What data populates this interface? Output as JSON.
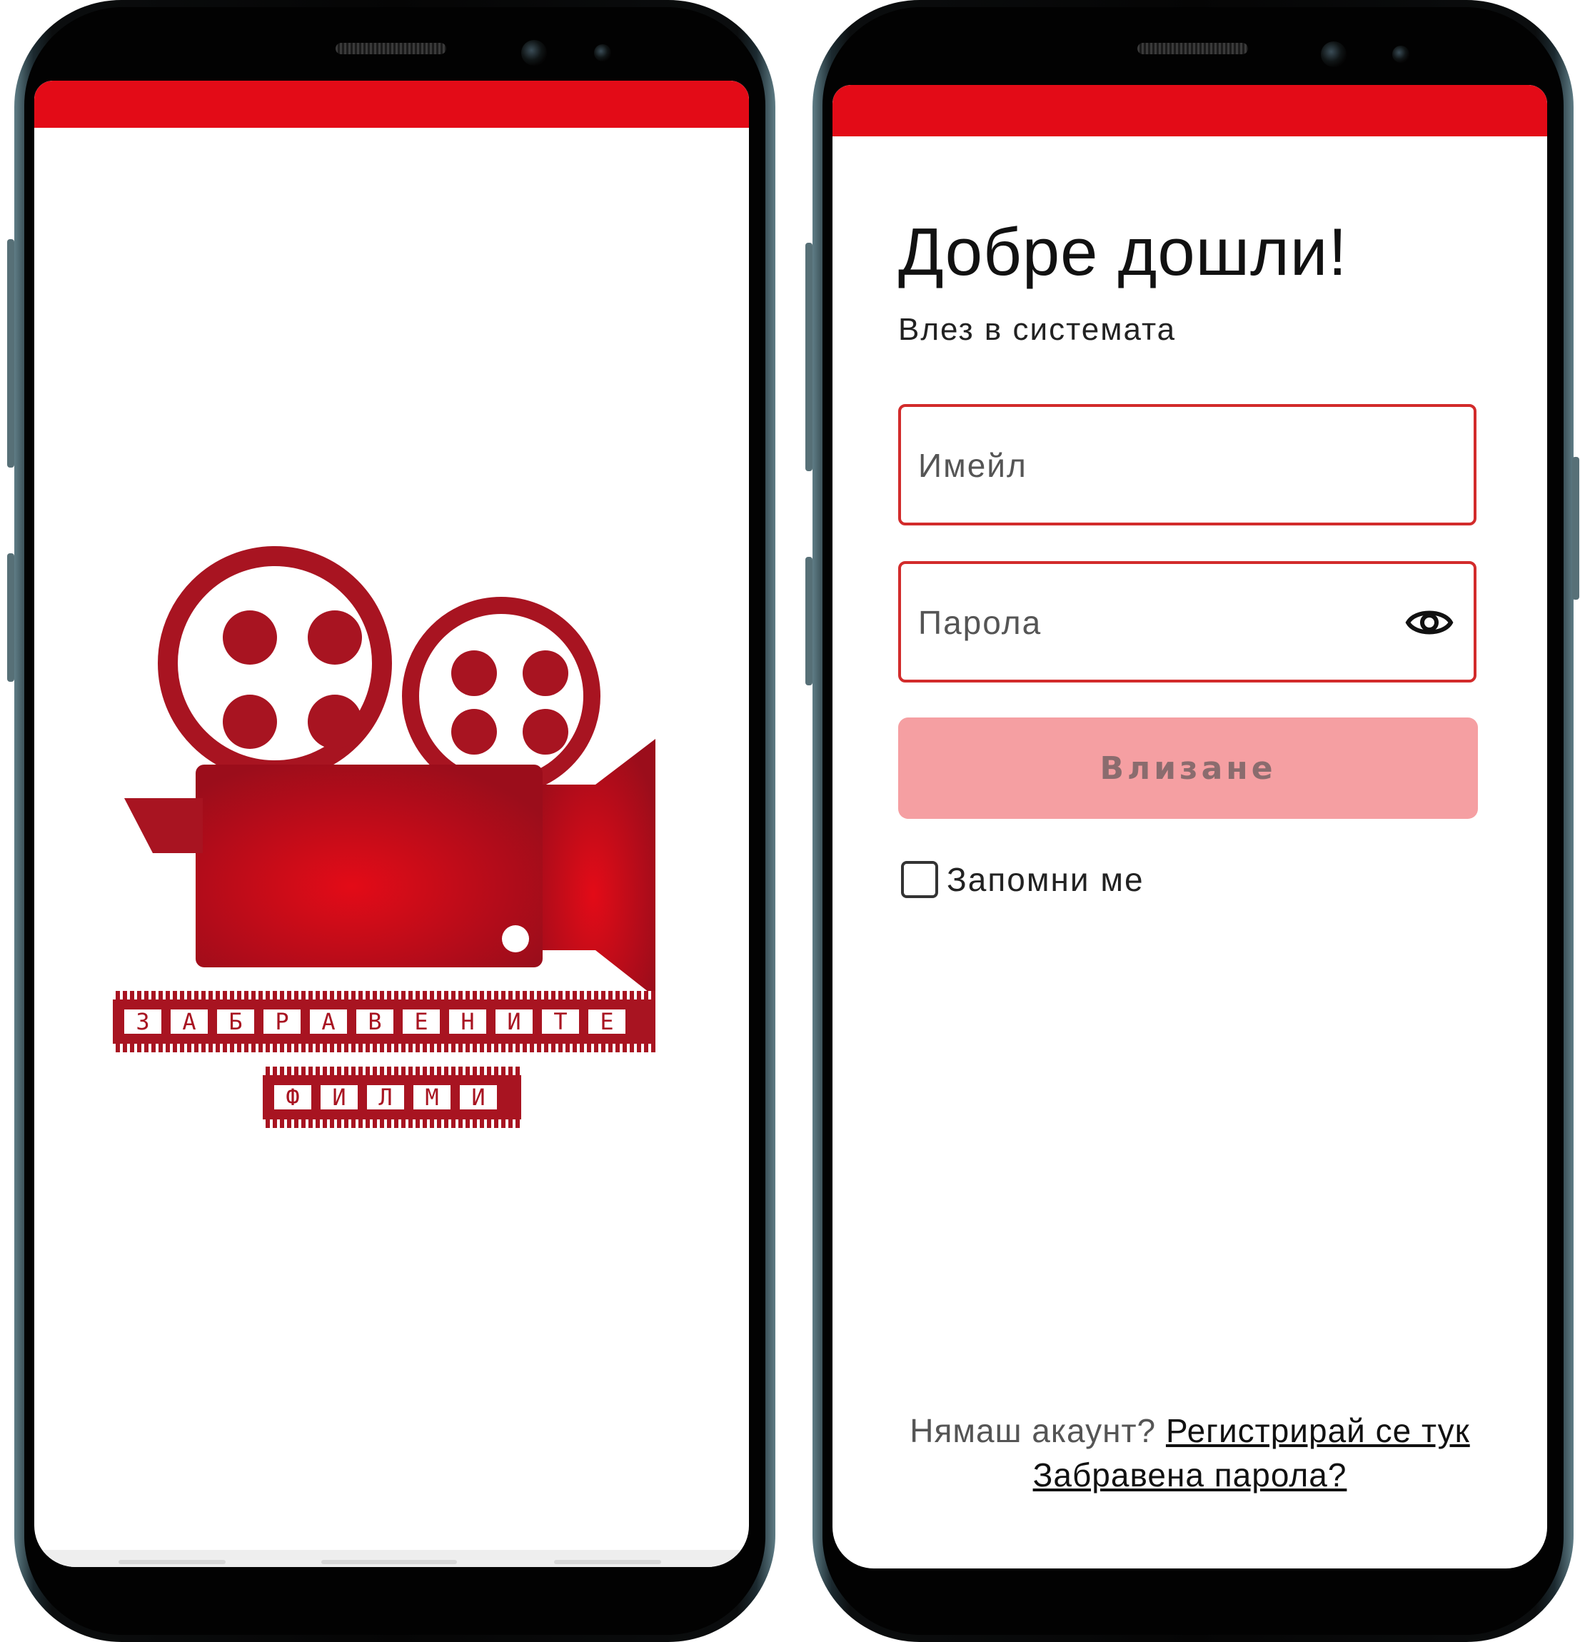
{
  "splash": {
    "logo_title_letters": [
      "З",
      "А",
      "Б",
      "Р",
      "А",
      "В",
      "Е",
      "Н",
      "И",
      "Т",
      "Е"
    ],
    "logo_subtitle_letters": [
      "Ф",
      "И",
      "Л",
      "М",
      "И"
    ],
    "logo_icon": "movie-camera-icon",
    "logo_color": "#a81421"
  },
  "login": {
    "title": "Добре дошли!",
    "subtitle": "Влез в системата",
    "email": {
      "placeholder": "Имейл",
      "value": ""
    },
    "password": {
      "placeholder": "Парола",
      "value": "",
      "toggle_icon": "eye-icon"
    },
    "submit_label": "Влизане",
    "remember_label": "Запомни ме",
    "remember_checked": false,
    "no_account_text": "Нямаш акаунт?",
    "register_link": "Регистрирай се тук",
    "forgot_link": "Забравена парола?"
  },
  "colors": {
    "accent_red": "#e30b17",
    "field_border": "#d22b2b",
    "button_disabled": "#f59fa2"
  }
}
